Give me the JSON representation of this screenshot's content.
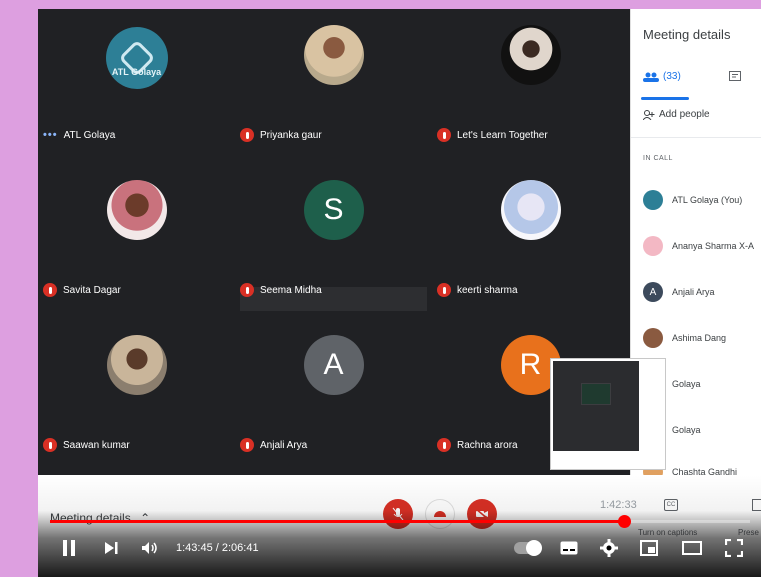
{
  "participants": [
    {
      "name": "ATL Golaya",
      "mic": "active",
      "avatar": "logo",
      "avatar_text": "ATL Golaya"
    },
    {
      "name": "Priyanka gaur",
      "mic": "muted",
      "avatar": "photo"
    },
    {
      "name": "Let's Learn Together",
      "mic": "muted",
      "avatar": "photo"
    },
    {
      "name": "Savita Dagar",
      "mic": "muted",
      "avatar": "photo"
    },
    {
      "name": "Seema Midha",
      "mic": "muted",
      "avatar": "letter",
      "letter": "S",
      "color": "#1e5f4b"
    },
    {
      "name": "keerti sharma",
      "mic": "muted",
      "avatar": "photo"
    },
    {
      "name": "Saawan kumar",
      "mic": "muted",
      "avatar": "photo"
    },
    {
      "name": "Anjali Arya",
      "mic": "muted",
      "avatar": "letter",
      "letter": "A",
      "color": "#5f6368"
    },
    {
      "name": "Rachna arora",
      "mic": "muted",
      "avatar": "letter",
      "letter": "R",
      "color": "#e8711c"
    }
  ],
  "panel": {
    "title": "Meeting details",
    "people_count": "(33)",
    "add_people": "Add people",
    "section_label": "IN CALL",
    "people": [
      {
        "name": "ATL Golaya (You)",
        "color": "#2d7f96",
        "letter": ""
      },
      {
        "name": "Ananya Sharma X-A",
        "color": "#f3b8c4",
        "letter": ""
      },
      {
        "name": "Anjali Arya",
        "color": "#3c4a5c",
        "letter": "A"
      },
      {
        "name": "Ashima Dang",
        "color": "#8a5a40",
        "letter": ""
      },
      {
        "name": "Golaya",
        "color": "#cccccc",
        "letter": ""
      },
      {
        "name": "Golaya",
        "color": "#cccccc",
        "letter": ""
      },
      {
        "name": "Chashta Gandhi",
        "color": "#e0a060",
        "letter": ""
      }
    ]
  },
  "meet_controls": {
    "meeting_details_label": "Meeting details",
    "clock": "1:42:33",
    "captions_label": "Turn on captions",
    "present_label": "Prese"
  },
  "player": {
    "current_time": "1:43:45",
    "duration": "2:06:41",
    "time_display": "1:43:45 / 2:06:41",
    "progress": 0.82
  },
  "colors": {
    "grid_bg": "#202124",
    "mute_red": "#d93025",
    "yt_red": "#ff0000",
    "accent_blue": "#1a73e8",
    "page_bg": "#dd9fe0"
  },
  "icons": [
    "mic-off-icon",
    "more-dots-icon",
    "people-icon",
    "chat-icon",
    "add-person-icon",
    "end-call-icon",
    "camera-off-icon",
    "captions-icon",
    "present-icon",
    "pause-icon",
    "next-icon",
    "volume-icon",
    "autoplay-toggle",
    "subtitles-icon",
    "settings-icon",
    "miniplayer-icon",
    "theater-icon",
    "fullscreen-icon"
  ]
}
